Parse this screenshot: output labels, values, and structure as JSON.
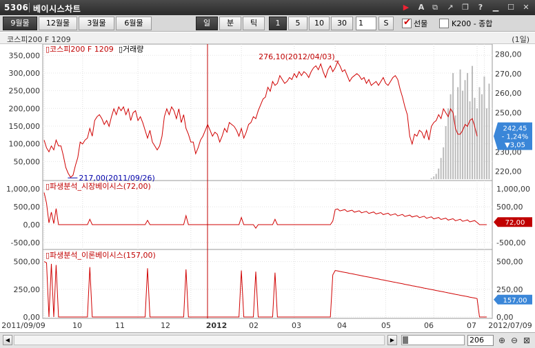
{
  "window": {
    "code": "5306",
    "title": "베이시스차트",
    "controls": [
      "arrow-right-icon",
      "font-icon",
      "copy-icon",
      "pin-icon",
      "restore-icon",
      "help-icon",
      "minimize-icon",
      "maximize-icon",
      "close-icon"
    ]
  },
  "toolbar": {
    "contracts": [
      "9월물",
      "12월물",
      "3월물",
      "6월물"
    ],
    "active_contract": 0,
    "periods": [
      "일",
      "분",
      "틱"
    ],
    "active_period": 0,
    "intervals": [
      "1",
      "5",
      "10",
      "30"
    ],
    "active_interval": 0,
    "interval_input": "1",
    "s_label": "S",
    "futures_label": "선물",
    "futures_checked": true,
    "k200_label": "K200 - 종합",
    "k200_checked": false
  },
  "chart_header": {
    "name": "코스피200 F 1209",
    "period": "(1일)"
  },
  "chart_data": [
    {
      "type": "line",
      "panel": "price",
      "legend": [
        "코스피200 F 1209",
        "거래량"
      ],
      "left_ticks": [
        "350,000",
        "300,000",
        "250,000",
        "200,000",
        "150,000",
        "100,000",
        "50,000"
      ],
      "right_ticks": [
        "280,00",
        "270,00",
        "260,00",
        "250,00",
        "240,00",
        "230,00",
        "220,00"
      ],
      "y_range": [
        216,
        283
      ],
      "volume_range": [
        0,
        370000
      ],
      "high_label": "276,10(2012/04/03)",
      "low_label": "217,00(2011/09/26)",
      "current_box": [
        "242,45",
        "- 1,24%",
        "▼3,05"
      ],
      "series": [
        {
          "name": "코스피200 F 1209",
          "values": [
            236,
            232,
            230,
            233,
            231,
            236,
            233,
            233,
            228,
            222,
            219,
            217,
            218,
            223,
            227,
            235,
            234,
            236,
            237,
            242,
            238,
            246,
            248,
            249,
            247,
            244,
            246,
            243,
            248,
            252,
            249,
            253,
            251,
            253,
            249,
            252,
            246,
            250,
            251,
            246,
            248,
            245,
            241,
            237,
            241,
            235,
            233,
            231,
            233,
            238,
            248,
            252,
            249,
            253,
            251,
            247,
            252,
            245,
            249,
            242,
            239,
            235,
            235,
            229,
            232,
            236,
            238,
            241,
            244,
            241,
            238,
            240,
            239,
            235,
            238,
            242,
            240,
            245,
            244,
            243,
            241,
            238,
            242,
            237,
            240,
            244,
            245,
            248,
            247,
            251,
            254,
            257,
            258,
            263,
            261,
            266,
            264,
            265,
            269,
            267,
            265,
            266,
            268,
            267,
            270,
            268,
            271,
            269,
            271,
            270,
            268,
            271,
            273,
            274,
            272,
            275,
            271,
            268,
            272,
            274,
            271,
            273,
            276,
            274,
            271,
            272,
            269,
            266,
            268,
            269,
            270,
            269,
            267,
            268,
            265,
            267,
            264,
            265,
            266,
            264,
            266,
            268,
            265,
            264,
            266,
            268,
            269,
            267,
            262,
            258,
            253,
            249,
            238,
            234,
            239,
            238,
            241,
            240,
            237,
            241,
            236,
            243,
            245,
            246,
            249,
            247,
            252,
            250,
            248,
            252,
            250,
            242,
            239,
            239,
            241,
            244,
            243,
            246,
            247,
            243,
            238
          ]
        },
        {
          "name": "거래량",
          "values": [
            0,
            0,
            0,
            0,
            0,
            0,
            0,
            0,
            0,
            0,
            0,
            0,
            0,
            0,
            0,
            0,
            0,
            0,
            0,
            0,
            0,
            0,
            0,
            0,
            0,
            0,
            0,
            0,
            0,
            0,
            0,
            0,
            0,
            0,
            0,
            0,
            0,
            0,
            0,
            0,
            0,
            0,
            0,
            0,
            0,
            0,
            0,
            0,
            0,
            0,
            0,
            0,
            0,
            0,
            0,
            0,
            0,
            0,
            0,
            0,
            0,
            0,
            0,
            0,
            0,
            0,
            0,
            0,
            0,
            0,
            0,
            0,
            0,
            0,
            0,
            0,
            0,
            0,
            0,
            0,
            0,
            0,
            0,
            0,
            0,
            0,
            0,
            0,
            0,
            0,
            0,
            0,
            0,
            0,
            0,
            0,
            0,
            0,
            0,
            0,
            0,
            0,
            0,
            0,
            0,
            0,
            0,
            0,
            0,
            0,
            0,
            0,
            0,
            0,
            0,
            0,
            0,
            0,
            0,
            0,
            0,
            0,
            0,
            0,
            0,
            0,
            0,
            0,
            0,
            0,
            0,
            0,
            0,
            0,
            0,
            0,
            0,
            0,
            0,
            0,
            0,
            0,
            0,
            0,
            0,
            0,
            0,
            0,
            0,
            0,
            0,
            0,
            0,
            0,
            0,
            0,
            0,
            0,
            0,
            0,
            0,
            3000,
            8000,
            15000,
            30000,
            60000,
            90000,
            150000,
            200000,
            240000,
            300000,
            180000,
            260000,
            310000,
            250000,
            280000,
            300000,
            220000,
            320000,
            230000,
            200000,
            260000,
            240000,
            290000,
            200000,
            270000
          ]
        }
      ]
    },
    {
      "type": "line",
      "panel": "market_basis",
      "legend": "파생분석_시장베이시스(72,00)",
      "left_ticks": [
        "1,000,00",
        "500,00",
        "0,00",
        "-500,00"
      ],
      "right_ticks": [
        "1,000,00",
        "500,00",
        "-500,00"
      ],
      "y_range": [
        -580,
        1100
      ],
      "current_box": "72,00",
      "values": [
        900,
        600,
        50,
        350,
        30,
        450,
        0,
        0,
        0,
        0,
        0,
        0,
        0,
        0,
        0,
        0,
        0,
        0,
        0,
        150,
        0,
        0,
        0,
        0,
        0,
        0,
        0,
        0,
        0,
        0,
        0,
        0,
        0,
        0,
        0,
        0,
        0,
        0,
        0,
        0,
        0,
        0,
        0,
        120,
        0,
        0,
        0,
        0,
        0,
        0,
        0,
        0,
        0,
        0,
        0,
        0,
        0,
        0,
        0,
        250,
        0,
        0,
        0,
        0,
        0,
        0,
        0,
        0,
        0,
        0,
        0,
        0,
        0,
        0,
        0,
        0,
        0,
        0,
        0,
        0,
        0,
        0,
        200,
        0,
        0,
        0,
        0,
        0,
        -100,
        0,
        0,
        0,
        0,
        0,
        0,
        0,
        150,
        0,
        0,
        0,
        0,
        0,
        0,
        0,
        0,
        0,
        0,
        0,
        0,
        0,
        0,
        0,
        0,
        0,
        0,
        0,
        0,
        0,
        0,
        0,
        100,
        0,
        0,
        0,
        0,
        0,
        0,
        0,
        0,
        0,
        0,
        0,
        0,
        0,
        0,
        0,
        0,
        0,
        0,
        0,
        0,
        0,
        0,
        0,
        0,
        0,
        0,
        0,
        0,
        0,
        0,
        0,
        0,
        0,
        0,
        0,
        0,
        0,
        0,
        0,
        0,
        0,
        0,
        0,
        0,
        0,
        0,
        0,
        0,
        0,
        0,
        0,
        0,
        0,
        0,
        0,
        0,
        0,
        0,
        0,
        0,
        0,
        0,
        0,
        0
      ]
    },
    {
      "type": "line",
      "panel": "theoretical_basis",
      "legend": "파생분석_이론베이시스(157,00)",
      "left_ticks": [
        "500,00",
        "250,00",
        "0,00"
      ],
      "y_range": [
        0,
        560
      ],
      "current_box": "157,00",
      "values": [
        500,
        490,
        0,
        480,
        0,
        470,
        0,
        0,
        0,
        0,
        0,
        0,
        0,
        0,
        0,
        0,
        0,
        0,
        0,
        450,
        0,
        0,
        0,
        0,
        0,
        0,
        0,
        0,
        0,
        0,
        0,
        0,
        0,
        0,
        0,
        0,
        0,
        0,
        0,
        0,
        0,
        0,
        0,
        440,
        0,
        0,
        0,
        0,
        0,
        0,
        0,
        0,
        0,
        0,
        0,
        0,
        0,
        0,
        0,
        430,
        0,
        0,
        0,
        0,
        0,
        0,
        0,
        0,
        0,
        0,
        0,
        0,
        0,
        0,
        0,
        0,
        0,
        0,
        0,
        0,
        0,
        0,
        420,
        0,
        0,
        0,
        0,
        0,
        410,
        0,
        0,
        0,
        0,
        0,
        0,
        0,
        400,
        0,
        0,
        0,
        0,
        0,
        0,
        0,
        0,
        0,
        0,
        0,
        0,
        0,
        0,
        0,
        0,
        0,
        0,
        0,
        0,
        0,
        0,
        0,
        380,
        0,
        0,
        0,
        0,
        0,
        0,
        0,
        0,
        0,
        0,
        0,
        0,
        0,
        0,
        0,
        0,
        0,
        0,
        0,
        0,
        0,
        0,
        0,
        0,
        0,
        0,
        0,
        0,
        0,
        0,
        0,
        0,
        0,
        0,
        0,
        0,
        0,
        0,
        0,
        0,
        0,
        0,
        0,
        0,
        0,
        0,
        0,
        0,
        0,
        0,
        0,
        0,
        0,
        0,
        0,
        0,
        0,
        0,
        0,
        0,
        0,
        0,
        0,
        0
      ]
    }
  ],
  "x_axis": {
    "labels": [
      "2011/09/09",
      "10",
      "11",
      "12",
      "2012",
      "02",
      "03",
      "04",
      "05",
      "06",
      "07",
      "2012/07/09"
    ]
  },
  "bottom": {
    "zoom_value": "206"
  }
}
